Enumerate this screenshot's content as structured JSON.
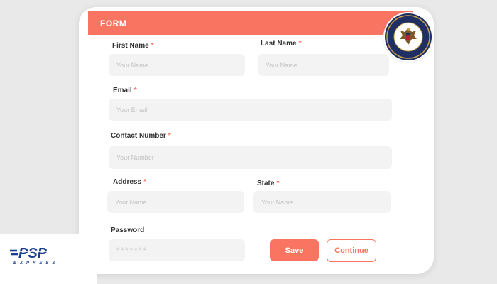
{
  "form": {
    "title": "FORM",
    "required_mark": "*",
    "first_name": {
      "label": "First Name",
      "placeholder": "Your Name"
    },
    "last_name": {
      "label": "Last Name",
      "placeholder": "Your Name"
    },
    "email": {
      "label": "Email",
      "placeholder": "Your Email"
    },
    "contact": {
      "label": "Contact Number",
      "placeholder": "Your Number"
    },
    "address": {
      "label": "Address",
      "placeholder": "Your Name"
    },
    "state": {
      "label": "State",
      "placeholder": "Your Name"
    },
    "password": {
      "label": "Password",
      "placeholder": "*******"
    },
    "save_label": "Save",
    "continue_label": "Continue"
  },
  "brand": {
    "accent_color": "#fa7561",
    "logo_text": "PSP",
    "logo_sub": "EXPRESS",
    "logo_color": "#1c3f8c",
    "seal_icon": "government-seal-icon"
  }
}
